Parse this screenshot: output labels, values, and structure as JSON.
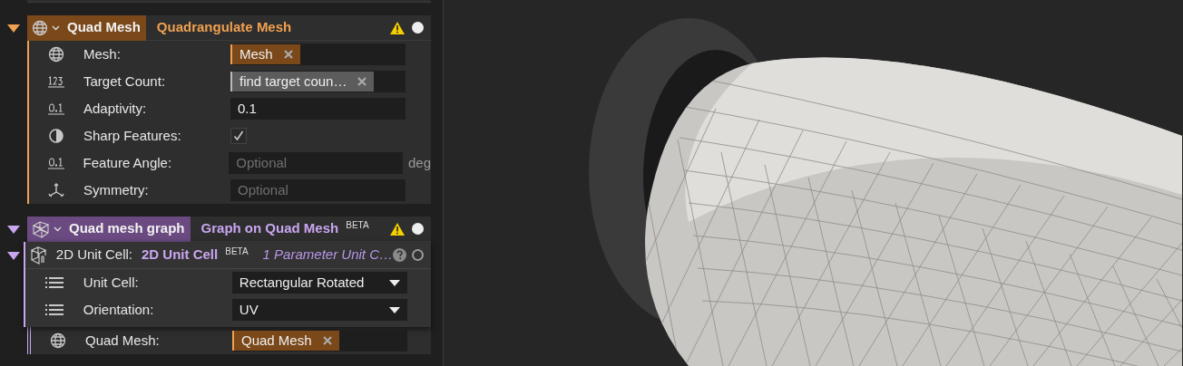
{
  "nodes": [
    {
      "kind": "quad",
      "expanded": true,
      "name": "Quad Mesh",
      "title": "Quadrangulate Mesh",
      "warning": true,
      "status_filled": true,
      "params": [
        {
          "kind": "mesh",
          "linked": true,
          "label": "Mesh:",
          "value": "Mesh"
        },
        {
          "kind": "integer",
          "linked": true,
          "label": "Target Count:",
          "value": "find target coun…"
        },
        {
          "kind": "decimal",
          "linked": false,
          "label": "Adaptivity:",
          "value": "0.1"
        },
        {
          "kind": "boolean",
          "label": "Sharp Features:",
          "checked": true
        },
        {
          "kind": "decimal",
          "linked": false,
          "label": "Feature Angle:",
          "placeholder": "Optional",
          "unit": "deg"
        },
        {
          "kind": "vector",
          "linked": false,
          "label": "Symmetry:",
          "placeholder": "Optional"
        }
      ]
    },
    {
      "kind": "graph",
      "expanded": true,
      "name": "Quad mesh graph",
      "title": "Graph on Quad Mesh",
      "badge": "BETA",
      "warning": true,
      "status_filled": true,
      "sub": {
        "expanded": true,
        "label": "2D Unit Cell:",
        "name": "2D Unit Cell",
        "badge": "BETA",
        "description": "1 Parameter Unit C…",
        "status_filled": false,
        "params": [
          {
            "kind": "enum",
            "label": "Unit Cell:",
            "value": "Rectangular Rotated"
          },
          {
            "kind": "enum",
            "label": "Orientation:",
            "value": "UV"
          }
        ]
      },
      "params": [
        {
          "kind": "mesh",
          "linked": true,
          "label": "Quad Mesh:",
          "value": "Quad Mesh"
        }
      ]
    }
  ]
}
